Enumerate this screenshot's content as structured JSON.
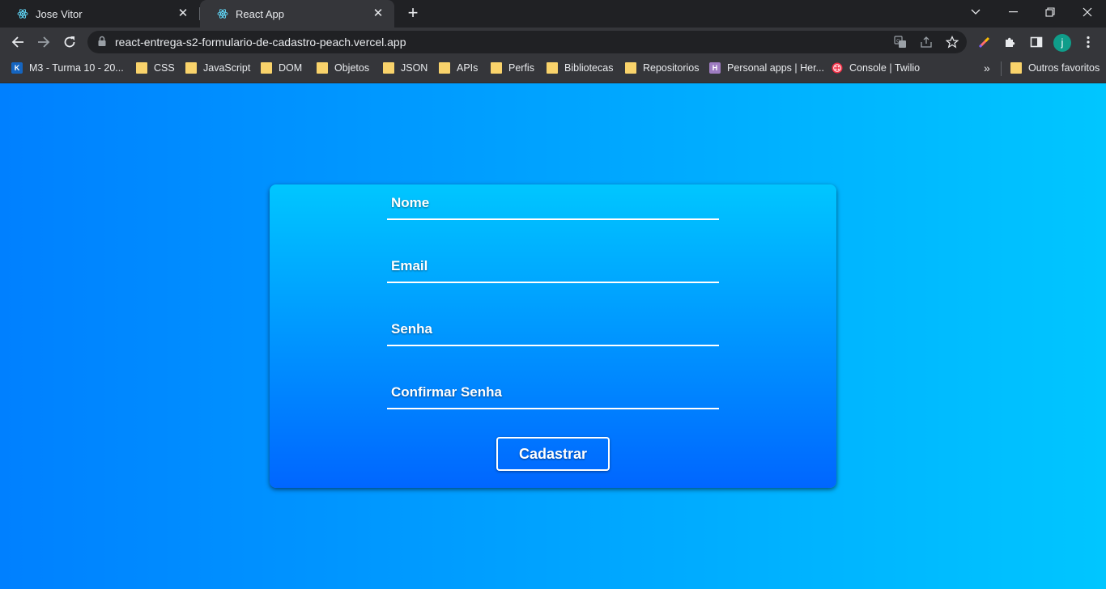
{
  "browser": {
    "tabs": [
      {
        "title": "Jose Vitor",
        "icon": "react-icon",
        "active": false
      },
      {
        "title": "React App",
        "icon": "react-icon",
        "active": true
      }
    ],
    "url": "react-entrega-s2-formulario-de-cadastro-peach.vercel.app",
    "profile_initial": "j",
    "bookmarks": [
      {
        "label": "M3 - Turma 10 - 20...",
        "icon": "kenzie-icon"
      },
      {
        "label": "CSS",
        "icon": "folder-icon"
      },
      {
        "label": "JavaScript",
        "icon": "folder-icon"
      },
      {
        "label": "DOM",
        "icon": "folder-icon"
      },
      {
        "label": "Objetos",
        "icon": "folder-icon"
      },
      {
        "label": "JSON",
        "icon": "folder-icon"
      },
      {
        "label": "APIs",
        "icon": "folder-icon"
      },
      {
        "label": "Perfis",
        "icon": "folder-icon"
      },
      {
        "label": "Bibliotecas",
        "icon": "folder-icon"
      },
      {
        "label": "Repositorios",
        "icon": "folder-icon"
      },
      {
        "label": "Personal apps | Her...",
        "icon": "heroku-icon"
      },
      {
        "label": "Console | Twilio",
        "icon": "twilio-icon"
      }
    ],
    "bookmarks_overflow": "»",
    "other_bookmarks": "Outros favoritos"
  },
  "form": {
    "fields": [
      {
        "placeholder": "Nome"
      },
      {
        "placeholder": "Email"
      },
      {
        "placeholder": "Senha"
      },
      {
        "placeholder": "Confirmar Senha"
      }
    ],
    "submit_label": "Cadastrar"
  },
  "colors": {
    "page_gradient_start": "#0080ff",
    "page_gradient_end": "#00c6ff",
    "card_gradient_top": "#00c6ff",
    "card_gradient_bottom": "#0066ff"
  }
}
